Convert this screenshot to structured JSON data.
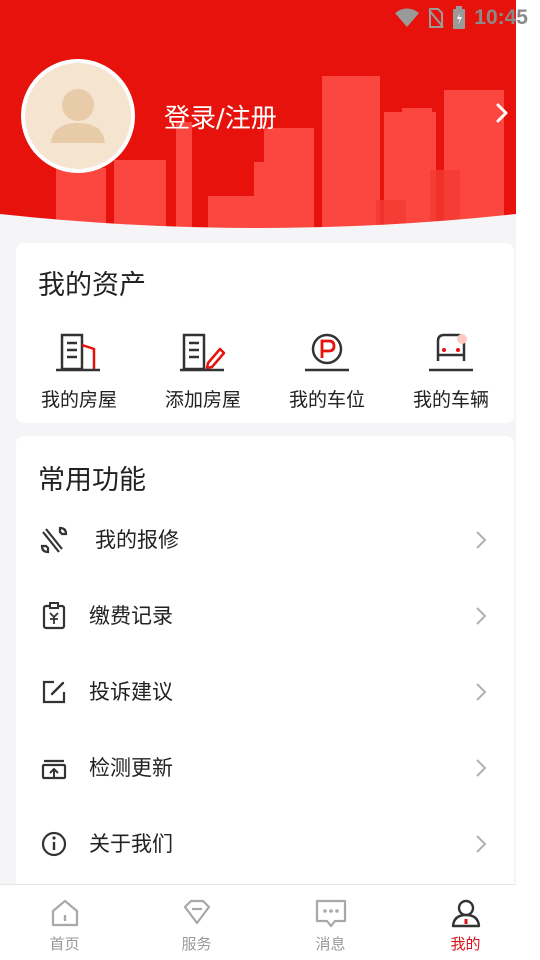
{
  "status_bar": {
    "time": "10:45",
    "icons": [
      "wifi-icon",
      "no-sim-icon",
      "battery-icon"
    ]
  },
  "header": {
    "login_label": "登录/注册",
    "avatar_icon": "user-avatar-icon",
    "arrow_icon": "chevron-right-icon"
  },
  "assets": {
    "title": "我的资产",
    "items": [
      {
        "label": "我的房屋",
        "icon": "building-icon"
      },
      {
        "label": "添加房屋",
        "icon": "building-edit-icon"
      },
      {
        "label": "我的车位",
        "icon": "parking-icon"
      },
      {
        "label": "我的车辆",
        "icon": "car-icon"
      }
    ]
  },
  "functions": {
    "title": "常用功能",
    "items": [
      {
        "label": "我的报修",
        "icon": "wrench-icon"
      },
      {
        "label": "缴费记录",
        "icon": "payment-record-icon"
      },
      {
        "label": "投诉建议",
        "icon": "edit-icon"
      },
      {
        "label": "检测更新",
        "icon": "update-icon"
      },
      {
        "label": "关于我们",
        "icon": "info-icon"
      }
    ]
  },
  "nav": {
    "items": [
      {
        "label": "首页",
        "icon": "home-icon",
        "active": false
      },
      {
        "label": "服务",
        "icon": "service-icon",
        "active": false
      },
      {
        "label": "消息",
        "icon": "message-icon",
        "active": false
      },
      {
        "label": "我的",
        "icon": "profile-icon",
        "active": true
      }
    ]
  },
  "colors": {
    "brand": "#e8120c",
    "active": "#d9141b",
    "text": "#222222",
    "muted": "#999999"
  }
}
